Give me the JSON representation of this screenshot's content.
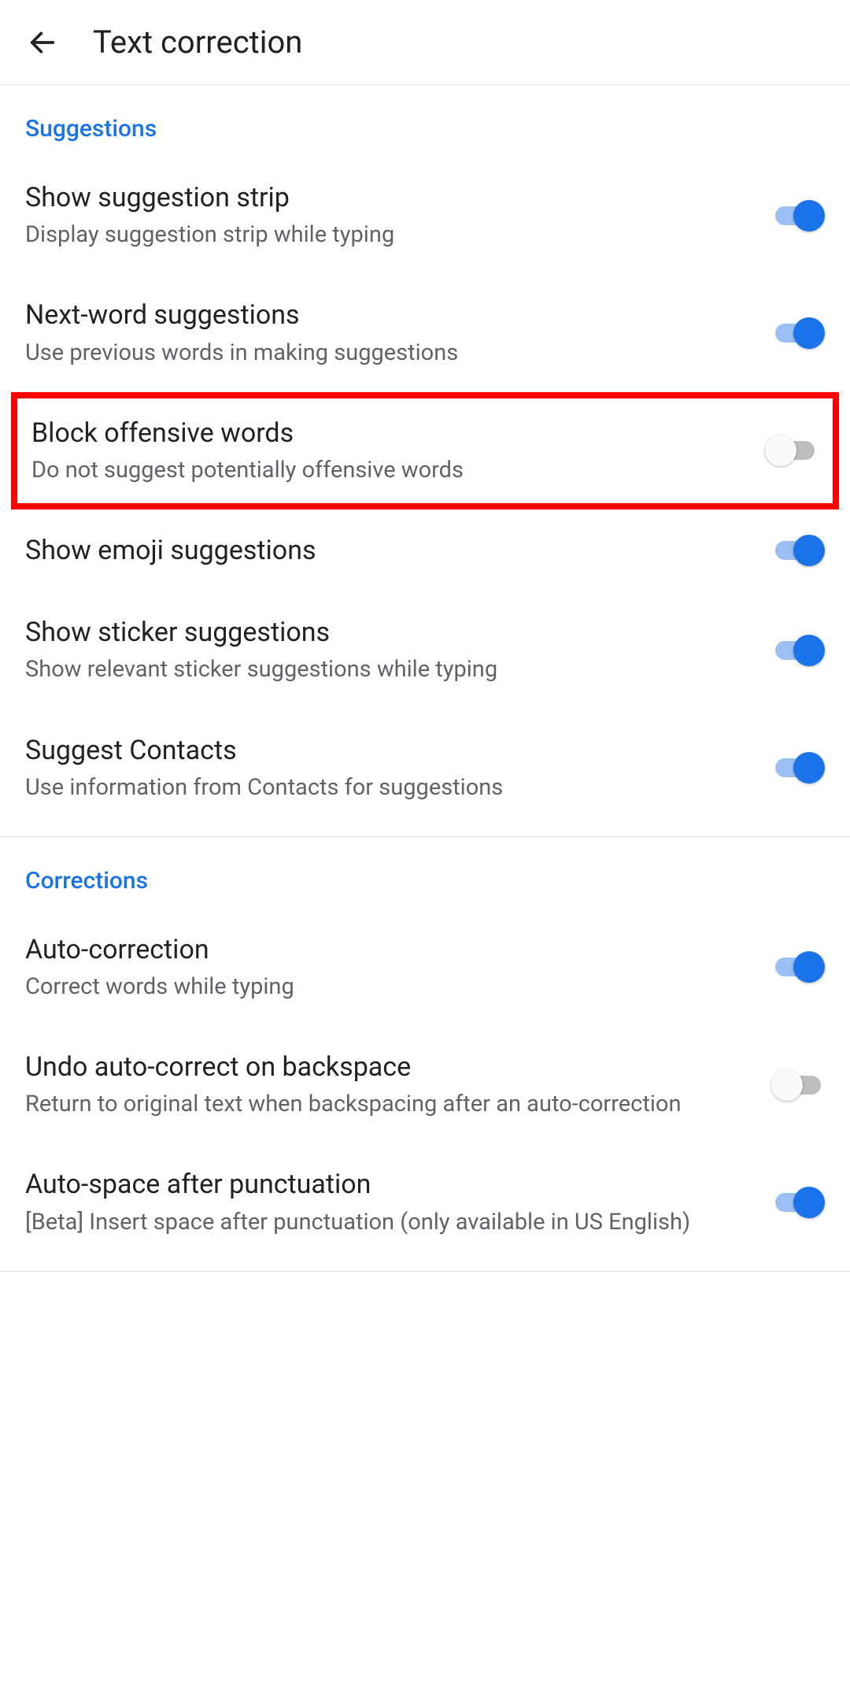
{
  "header": {
    "title": "Text correction"
  },
  "sections": {
    "suggestions": {
      "header": "Suggestions",
      "items": {
        "show_suggestion_strip": {
          "title": "Show suggestion strip",
          "subtitle": "Display suggestion strip while typing",
          "enabled": true
        },
        "next_word": {
          "title": "Next-word suggestions",
          "subtitle": "Use previous words in making suggestions",
          "enabled": true
        },
        "block_offensive": {
          "title": "Block offensive words",
          "subtitle": "Do not suggest potentially offensive words",
          "enabled": false
        },
        "emoji": {
          "title": "Show emoji suggestions",
          "enabled": true
        },
        "sticker": {
          "title": "Show sticker suggestions",
          "subtitle": "Show relevant sticker suggestions while typing",
          "enabled": true
        },
        "contacts": {
          "title": "Suggest Contacts",
          "subtitle": "Use information from Contacts for suggestions",
          "enabled": true
        }
      }
    },
    "corrections": {
      "header": "Corrections",
      "items": {
        "auto_correction": {
          "title": "Auto-correction",
          "subtitle": "Correct words while typing",
          "enabled": true
        },
        "undo_backspace": {
          "title": "Undo auto-correct on backspace",
          "subtitle": "Return to original text when backspacing after an auto-correction",
          "enabled": false
        },
        "auto_space": {
          "title": "Auto-space after punctuation",
          "subtitle": "[Beta] Insert space after punctuation (only available in US English)",
          "enabled": true
        }
      }
    }
  }
}
